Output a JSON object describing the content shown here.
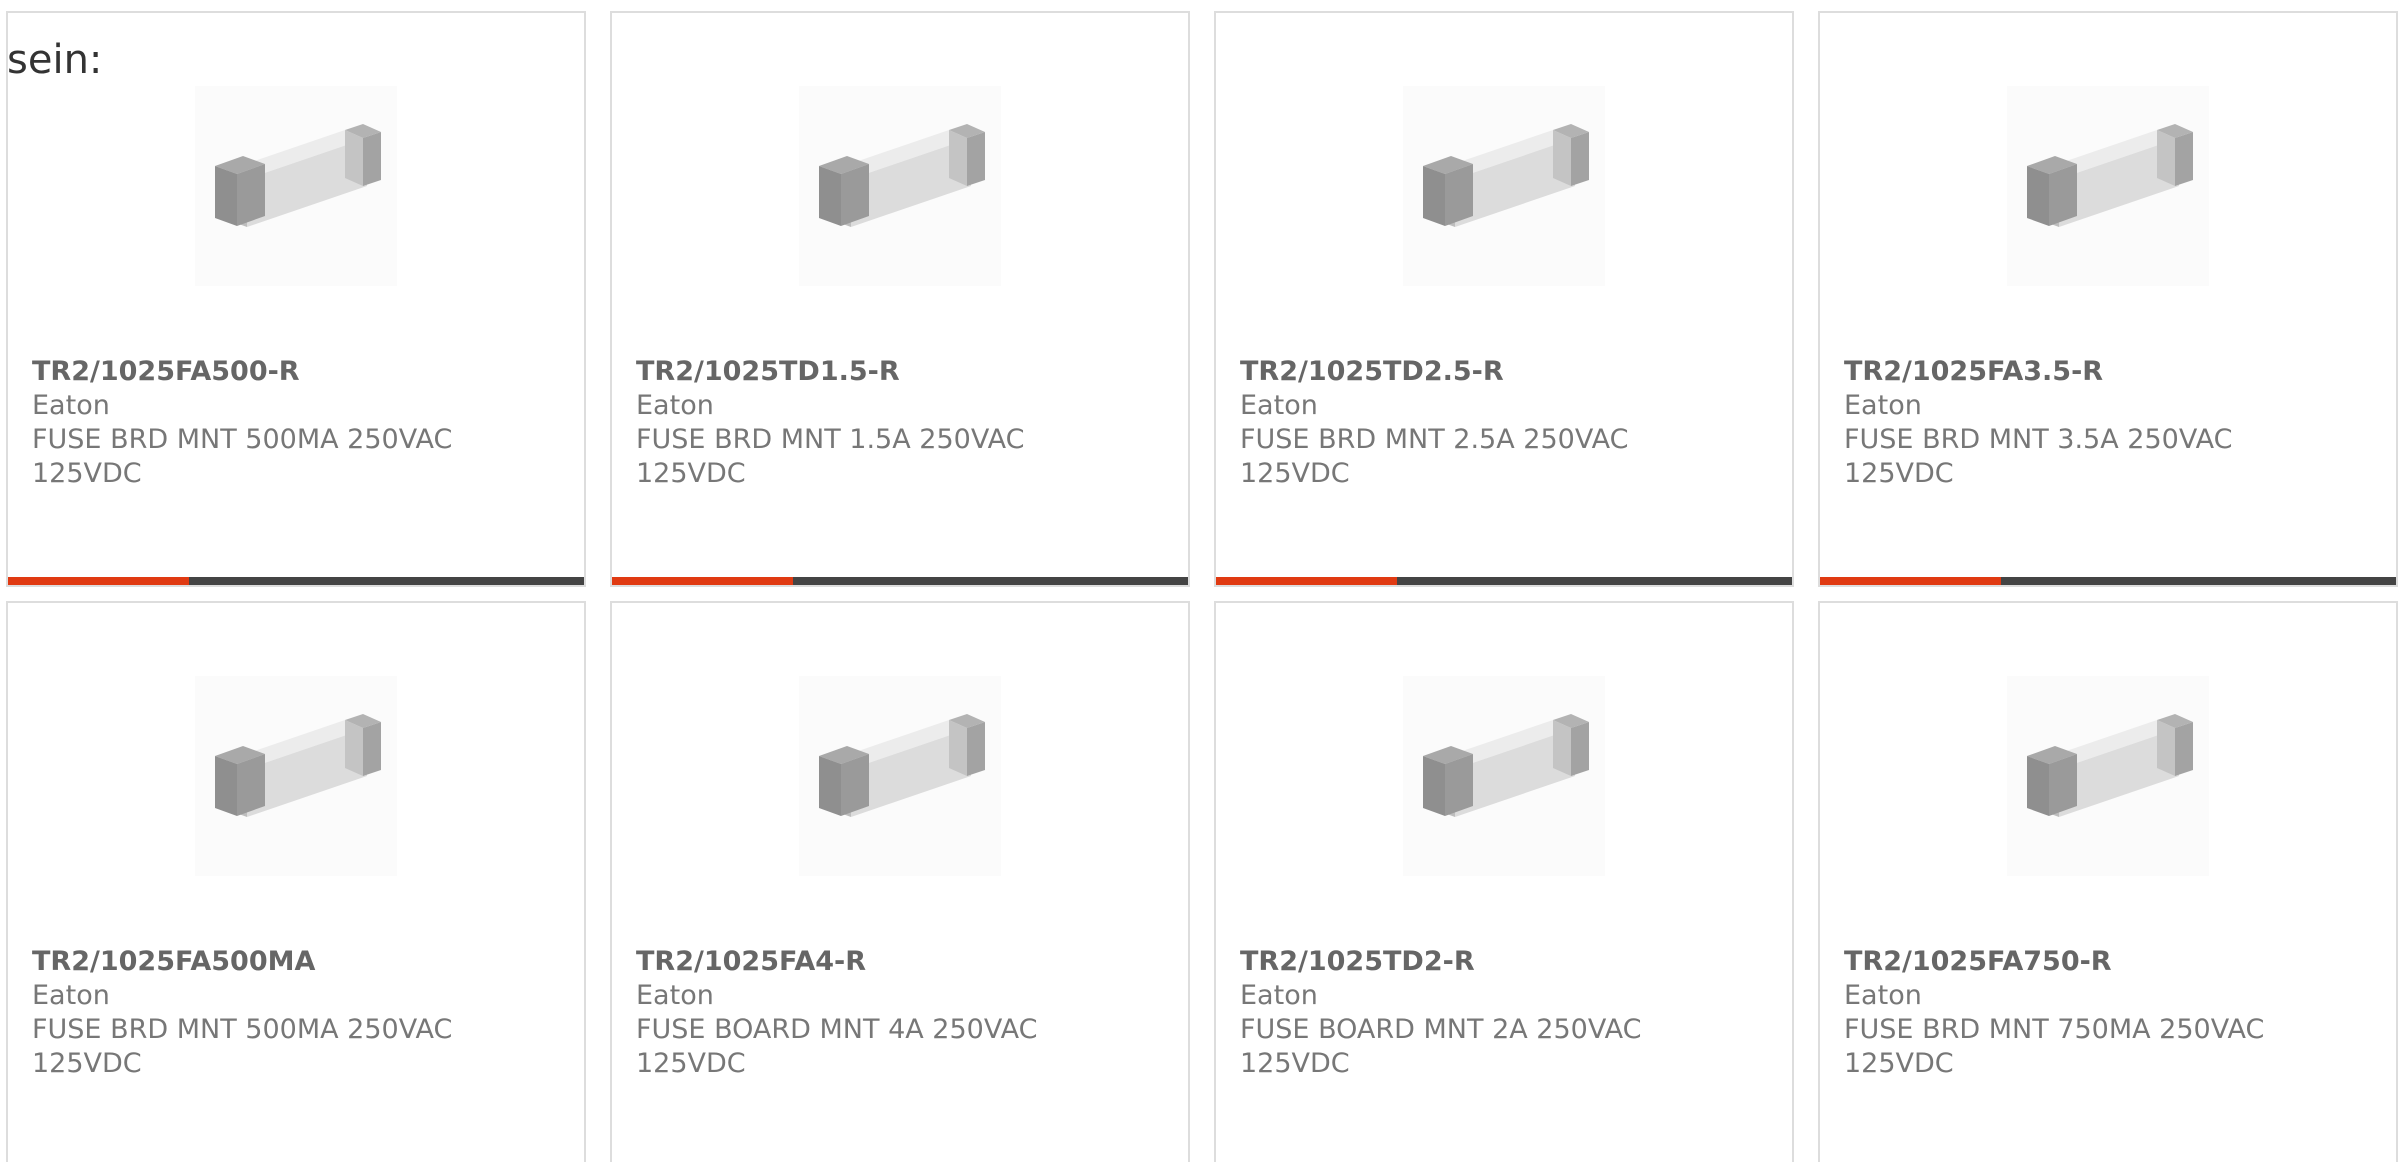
{
  "intro_text": "sein:",
  "colors": {
    "accent": "#e03a12",
    "bar_dark": "#444444",
    "card_border": "#dddddd",
    "text": "#777777"
  },
  "icons": {
    "product_image": "fuse-image"
  },
  "products": [
    {
      "part": "TR2/1025FA500-R",
      "brand": "Eaton",
      "desc1": "FUSE BRD MNT 500MA 250VAC",
      "desc2": "125VDC",
      "accent_fraction": 0.315
    },
    {
      "part": "TR2/1025TD1.5-R",
      "brand": "Eaton",
      "desc1": "FUSE BRD MNT 1.5A 250VAC",
      "desc2": "125VDC",
      "accent_fraction": 0.315
    },
    {
      "part": "TR2/1025TD2.5-R",
      "brand": "Eaton",
      "desc1": "FUSE BRD MNT 2.5A 250VAC",
      "desc2": "125VDC",
      "accent_fraction": 0.315
    },
    {
      "part": "TR2/1025FA3.5-R",
      "brand": "Eaton",
      "desc1": "FUSE BRD MNT 3.5A 250VAC",
      "desc2": "125VDC",
      "accent_fraction": 0.315
    },
    {
      "part": "TR2/1025FA500MA",
      "brand": "Eaton",
      "desc1": "FUSE BRD MNT 500MA 250VAC",
      "desc2": "125VDC"
    },
    {
      "part": "TR2/1025FA4-R",
      "brand": "Eaton",
      "desc1": "FUSE BOARD MNT 4A 250VAC",
      "desc2": "125VDC"
    },
    {
      "part": "TR2/1025TD2-R",
      "brand": "Eaton",
      "desc1": "FUSE BOARD MNT 2A 250VAC",
      "desc2": "125VDC"
    },
    {
      "part": "TR2/1025FA750-R",
      "brand": "Eaton",
      "desc1": "FUSE BRD MNT 750MA 250VAC",
      "desc2": "125VDC"
    }
  ]
}
